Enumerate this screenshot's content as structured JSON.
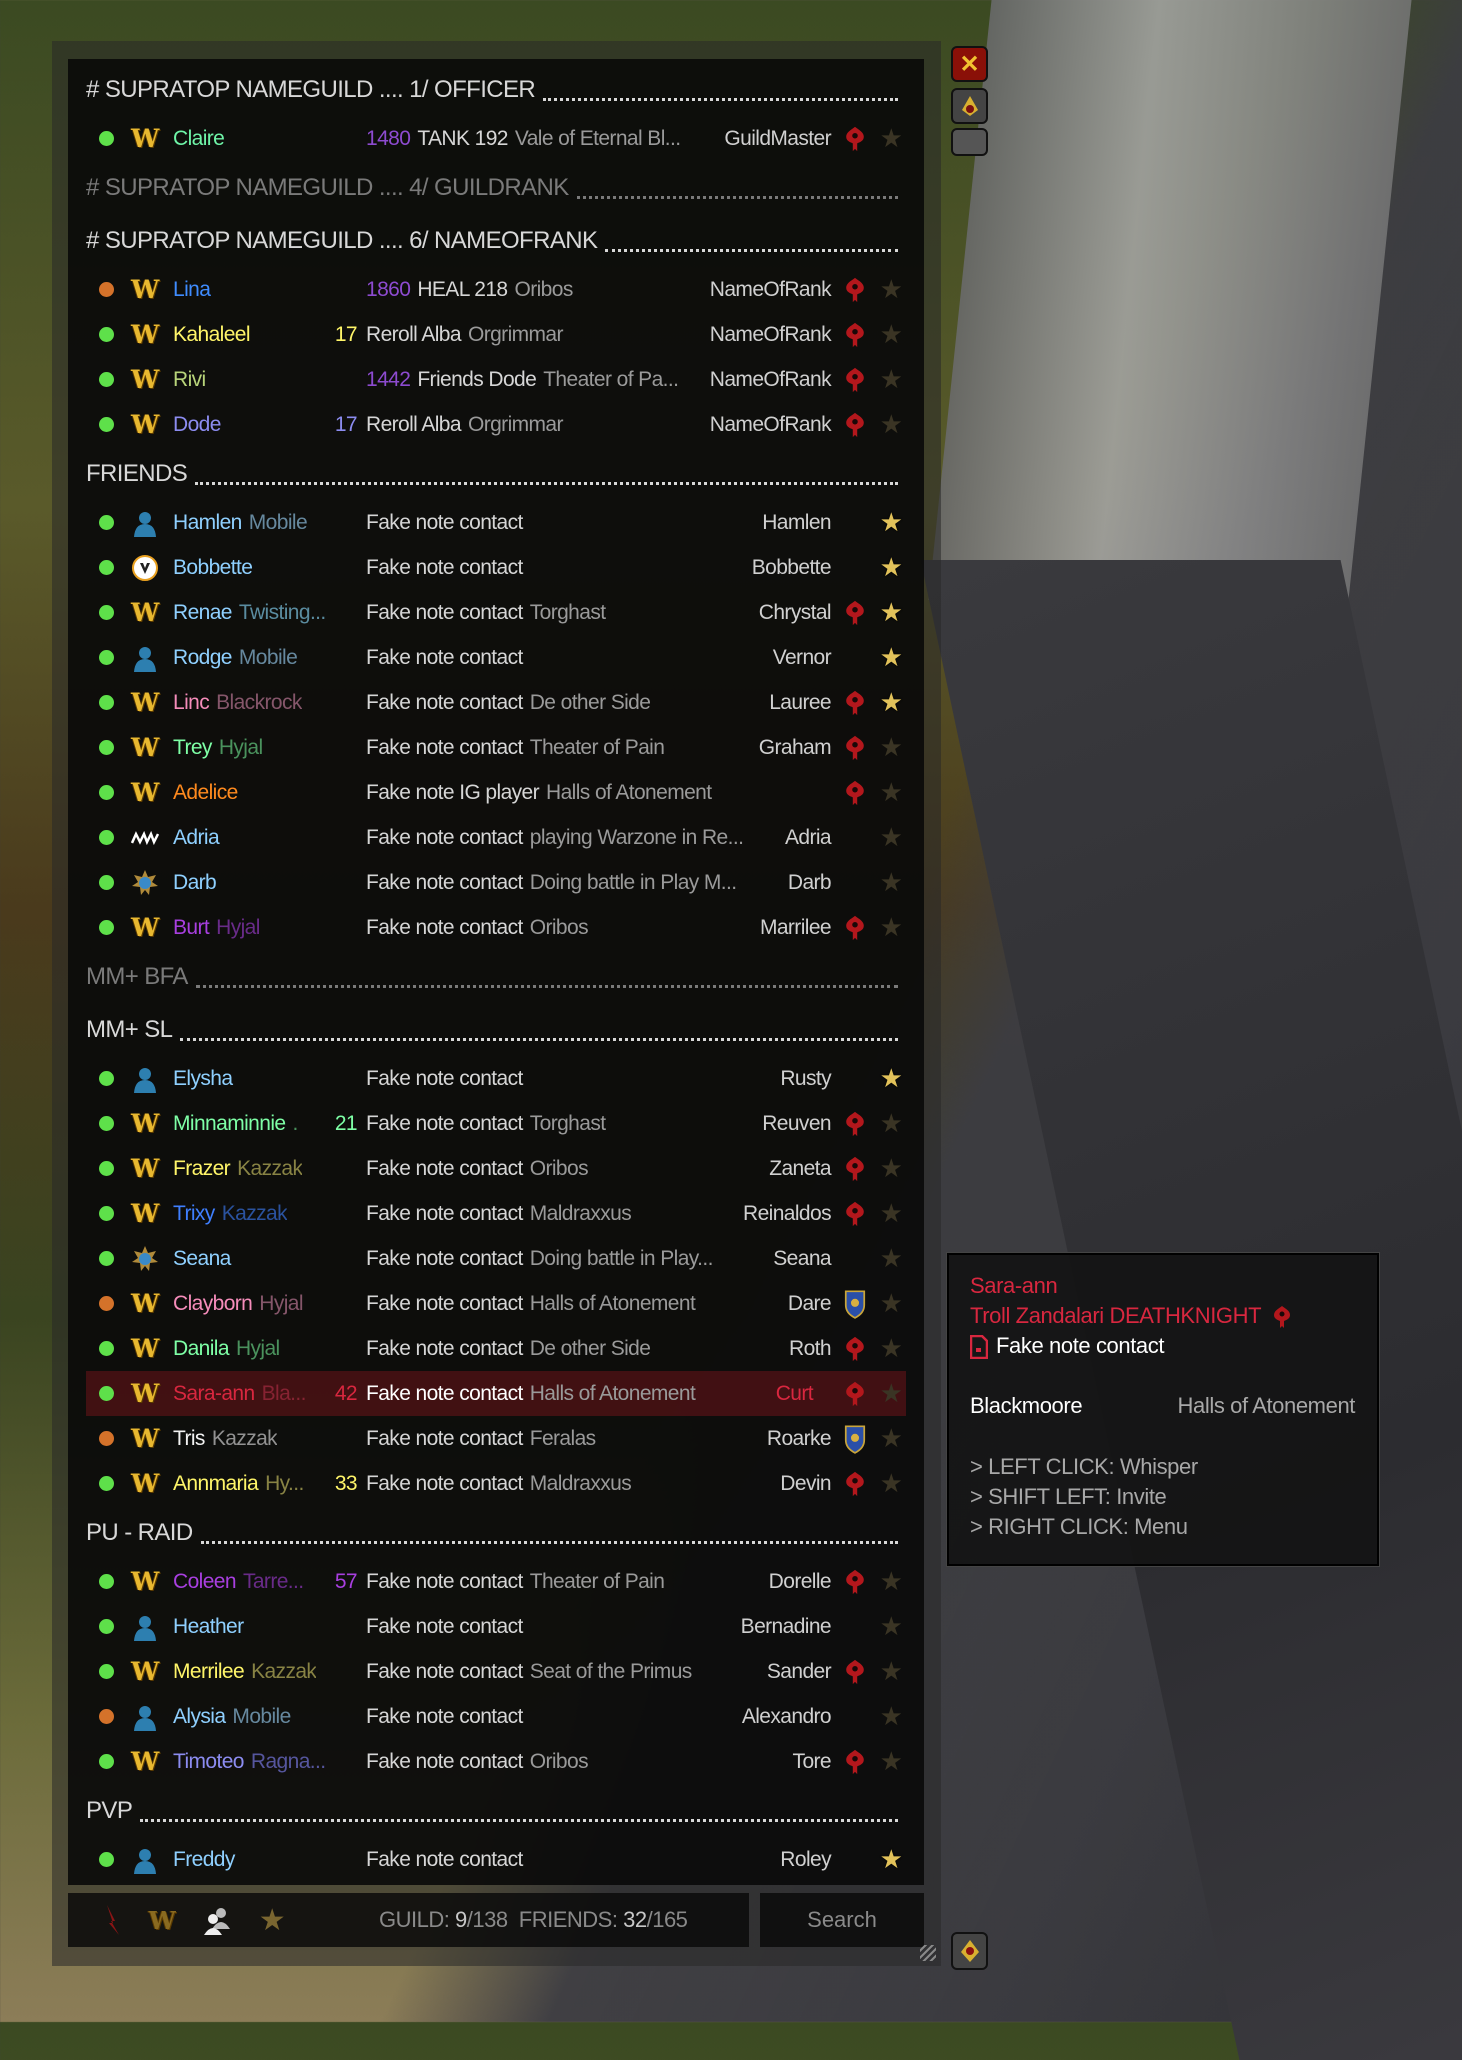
{
  "colors": {
    "online": "#5ee04a",
    "away": "#d4722a",
    "horde": "#b3171c",
    "alliance": "#2a4fa8",
    "highlight": "#6e1419"
  },
  "sections": [
    {
      "title": "# SUPRATOP NAMEGUILD .... 1/ OFFICER",
      "collapsed": false,
      "members": [
        {
          "status": "online",
          "icon": "wow",
          "name": "Claire",
          "nc": "#6ff5a8",
          "realm": "",
          "rc": "",
          "level": "",
          "lc": "",
          "score": "1480",
          "scc": "#8d4bd0",
          "note": "TANK 192",
          "zone": "Vale of Eternal Bl...",
          "rank": "GuildMaster",
          "faction": "horde",
          "fav": false
        }
      ]
    },
    {
      "title": "# SUPRATOP NAMEGUILD .... 4/ GUILDRANK",
      "collapsed": true,
      "members": []
    },
    {
      "title": "# SUPRATOP NAMEGUILD .... 6/ NAMEOFRANK",
      "collapsed": false,
      "members": [
        {
          "status": "away",
          "icon": "wow",
          "name": "Lina",
          "nc": "#3f8cff",
          "realm": "",
          "rc": "",
          "level": "",
          "lc": "",
          "score": "1860",
          "scc": "#8d4bd0",
          "note": "HEAL 218",
          "zone": "Oribos",
          "rank": "NameOfRank",
          "faction": "horde",
          "fav": false
        },
        {
          "status": "online",
          "icon": "wow",
          "name": "Kahaleel",
          "nc": "#fff569",
          "realm": "",
          "rc": "",
          "level": "17",
          "lc": "#fff569",
          "score": "",
          "scc": "",
          "note": "Reroll Alba",
          "zone": "Orgrimmar",
          "rank": "NameOfRank",
          "faction": "horde",
          "fav": false
        },
        {
          "status": "online",
          "icon": "wow",
          "name": "Rivi",
          "nc": "#b8d47a",
          "realm": "",
          "rc": "",
          "level": "",
          "lc": "",
          "score": "1442",
          "scc": "#8d4bd0",
          "note": "Friends Dode",
          "zone": "Theater of Pa...",
          "rank": "NameOfRank",
          "faction": "horde",
          "fav": false
        },
        {
          "status": "online",
          "icon": "wow",
          "name": "Dode",
          "nc": "#8c8cf0",
          "realm": "",
          "rc": "",
          "level": "17",
          "lc": "#8c8cf0",
          "score": "",
          "scc": "",
          "note": "Reroll Alba",
          "zone": "Orgrimmar",
          "rank": "NameOfRank",
          "faction": "horde",
          "fav": false
        }
      ]
    },
    {
      "title": "FRIENDS",
      "collapsed": false,
      "members": [
        {
          "status": "online",
          "icon": "bnet",
          "name": "Hamlen",
          "nc": "#8fd0ff",
          "realm": "Mobile",
          "rc": "#6b8fa6",
          "level": "",
          "lc": "",
          "score": "",
          "scc": "",
          "note": "Fake note contact",
          "zone": "",
          "rank": "Hamlen",
          "faction": "none",
          "fav": true
        },
        {
          "status": "online",
          "icon": "overwatch",
          "name": "Bobbette",
          "nc": "#8fd0ff",
          "realm": "",
          "rc": "",
          "level": "",
          "lc": "",
          "score": "",
          "scc": "",
          "note": "Fake note contact",
          "zone": "",
          "rank": "Bobbette",
          "faction": "none",
          "fav": true
        },
        {
          "status": "online",
          "icon": "wow",
          "name": "Renae",
          "nc": "#8fd0ff",
          "realm": "Twisting...",
          "rc": "#5f93a8",
          "level": "",
          "lc": "",
          "score": "",
          "scc": "",
          "note": "Fake note contact",
          "zone": "Torghast",
          "rank": "Chrystal",
          "faction": "horde",
          "fav": true
        },
        {
          "status": "online",
          "icon": "bnet",
          "name": "Rodge",
          "nc": "#8fd0ff",
          "realm": "Mobile",
          "rc": "#6b8fa6",
          "level": "",
          "lc": "",
          "score": "",
          "scc": "",
          "note": "Fake note contact",
          "zone": "",
          "rank": "Vernor",
          "faction": "none",
          "fav": true
        },
        {
          "status": "online",
          "icon": "wow",
          "name": "Linc",
          "nc": "#f58cba",
          "realm": "Blackrock",
          "rc": "#8c5a70",
          "level": "",
          "lc": "",
          "score": "",
          "scc": "",
          "note": "Fake note contact",
          "zone": "De other Side",
          "rank": "Lauree",
          "faction": "horde",
          "fav": true
        },
        {
          "status": "online",
          "icon": "wow",
          "name": "Trey",
          "nc": "#7effa6",
          "realm": "Hyjal",
          "rc": "#4e9a62",
          "level": "",
          "lc": "",
          "score": "",
          "scc": "",
          "note": "Fake note contact",
          "zone": "Theater of Pain",
          "rank": "Graham",
          "faction": "horde",
          "fav": false
        },
        {
          "status": "online",
          "icon": "wow",
          "name": "Adelice",
          "nc": "#ff8a1e",
          "realm": "",
          "rc": "",
          "level": "",
          "lc": "",
          "score": "",
          "scc": "",
          "note": "Fake note IG player",
          "zone": "Halls of Atonement",
          "rank": "",
          "faction": "horde",
          "fav": false
        },
        {
          "status": "online",
          "icon": "cod",
          "name": "Adria",
          "nc": "#8fd0ff",
          "realm": "",
          "rc": "",
          "level": "",
          "lc": "",
          "score": "",
          "scc": "",
          "note": "Fake note contact",
          "zone": "playing Warzone in Re...",
          "rank": "Adria",
          "faction": "none",
          "fav": false
        },
        {
          "status": "online",
          "icon": "hearthstone",
          "name": "Darb",
          "nc": "#8fd0ff",
          "realm": "",
          "rc": "",
          "level": "",
          "lc": "",
          "score": "",
          "scc": "",
          "note": "Fake note contact",
          "zone": "Doing battle in Play M...",
          "rank": "Darb",
          "faction": "none",
          "fav": false
        },
        {
          "status": "online",
          "icon": "wow",
          "name": "Burt",
          "nc": "#a83fe0",
          "realm": "Hyjal",
          "rc": "#6e2d90",
          "level": "",
          "lc": "",
          "score": "",
          "scc": "",
          "note": "Fake note contact",
          "zone": "Oribos",
          "rank": "Marrilee",
          "faction": "horde",
          "fav": false
        }
      ]
    },
    {
      "title": "MM+ BFA",
      "collapsed": true,
      "members": []
    },
    {
      "title": "MM+ SL",
      "collapsed": false,
      "members": [
        {
          "status": "online",
          "icon": "bnet",
          "name": "Elysha",
          "nc": "#8fd0ff",
          "realm": "",
          "rc": "",
          "level": "",
          "lc": "",
          "score": "",
          "scc": "",
          "note": "Fake note contact",
          "zone": "",
          "rank": "Rusty",
          "faction": "none",
          "fav": true
        },
        {
          "status": "online",
          "icon": "wow",
          "name": "Minnaminnie",
          "nc": "#7effa6",
          "realm": ".",
          "rc": "#4e9a62",
          "level": "21",
          "lc": "#7effa6",
          "score": "",
          "scc": "",
          "note": "Fake note contact",
          "zone": "Torghast",
          "rank": "Reuven",
          "faction": "horde",
          "fav": false
        },
        {
          "status": "online",
          "icon": "wow",
          "name": "Frazer",
          "nc": "#fff569",
          "realm": "Kazzak",
          "rc": "#8f8a48",
          "level": "",
          "lc": "",
          "score": "",
          "scc": "",
          "note": "Fake note contact",
          "zone": "Oribos",
          "rank": "Zaneta",
          "faction": "horde",
          "fav": false
        },
        {
          "status": "online",
          "icon": "wow",
          "name": "Trixy",
          "nc": "#3f7fff",
          "realm": "Kazzak",
          "rc": "#2c56a6",
          "level": "",
          "lc": "",
          "score": "",
          "scc": "",
          "note": "Fake note contact",
          "zone": "Maldraxxus",
          "rank": "Reinaldos",
          "faction": "horde",
          "fav": false
        },
        {
          "status": "online",
          "icon": "hearthstone",
          "name": "Seana",
          "nc": "#8fd0ff",
          "realm": "",
          "rc": "",
          "level": "",
          "lc": "",
          "score": "",
          "scc": "",
          "note": "Fake note contact",
          "zone": "Doing battle in Play...",
          "rank": "Seana",
          "faction": "none",
          "fav": false
        },
        {
          "status": "away",
          "icon": "wow",
          "name": "Clayborn",
          "nc": "#f58cba",
          "realm": "Hyjal",
          "rc": "#8c5a70",
          "level": "",
          "lc": "",
          "score": "",
          "scc": "",
          "note": "Fake note contact",
          "zone": "Halls of Atonement",
          "rank": "Dare",
          "faction": "alliance",
          "fav": false
        },
        {
          "status": "online",
          "icon": "wow",
          "name": "Danila",
          "nc": "#7effa6",
          "realm": "Hyjal",
          "rc": "#4e9a62",
          "level": "",
          "lc": "",
          "score": "",
          "scc": "",
          "note": "Fake note contact",
          "zone": "De other Side",
          "rank": "Roth",
          "faction": "horde",
          "fav": false
        },
        {
          "status": "online",
          "icon": "wow",
          "name": "Sara-ann",
          "nc": "#d8273f",
          "realm": "Bla...",
          "rc": "#8a2434",
          "level": "42",
          "lc": "#d8273f",
          "score": "",
          "scc": "",
          "note": "Fake note contact",
          "zone": "Halls of Atonement",
          "rank": "Curt",
          "rkc": "#d8273f",
          "faction": "horde",
          "fav": false,
          "highlight": true
        },
        {
          "status": "away",
          "icon": "wow",
          "name": "Tris",
          "nc": "#f2f2f2",
          "realm": "Kazzak",
          "rc": "#9a9a9a",
          "level": "",
          "lc": "",
          "score": "",
          "scc": "",
          "note": "Fake note contact",
          "zone": "Feralas",
          "rank": "Roarke",
          "faction": "alliance",
          "fav": false
        },
        {
          "status": "online",
          "icon": "wow",
          "name": "Annmaria",
          "nc": "#fff569",
          "realm": "Hy...",
          "rc": "#8f8a48",
          "level": "33",
          "lc": "#fff569",
          "score": "",
          "scc": "",
          "note": "Fake note contact",
          "zone": "Maldraxxus",
          "rank": "Devin",
          "faction": "horde",
          "fav": false
        }
      ]
    },
    {
      "title": "PU - RAID",
      "collapsed": false,
      "members": [
        {
          "status": "online",
          "icon": "wow",
          "name": "Coleen",
          "nc": "#a83fe0",
          "realm": "Tarre...",
          "rc": "#6e2d90",
          "level": "57",
          "lc": "#a83fe0",
          "score": "",
          "scc": "",
          "note": "Fake note contact",
          "zone": "Theater of Pain",
          "rank": "Dorelle",
          "faction": "horde",
          "fav": false
        },
        {
          "status": "online",
          "icon": "bnet",
          "name": "Heather",
          "nc": "#8fd0ff",
          "realm": "",
          "rc": "",
          "level": "",
          "lc": "",
          "score": "",
          "scc": "",
          "note": "Fake note contact",
          "zone": "",
          "rank": "Bernadine",
          "faction": "none",
          "fav": false
        },
        {
          "status": "online",
          "icon": "wow",
          "name": "Merrilee",
          "nc": "#fff569",
          "realm": "Kazzak",
          "rc": "#8f8a48",
          "level": "",
          "lc": "",
          "score": "",
          "scc": "",
          "note": "Fake note contact",
          "zone": "Seat of the Primus",
          "rank": "Sander",
          "faction": "horde",
          "fav": false
        },
        {
          "status": "away",
          "icon": "bnet",
          "name": "Alysia",
          "nc": "#8fd0ff",
          "realm": "Mobile",
          "rc": "#6b8fa6",
          "level": "",
          "lc": "",
          "score": "",
          "scc": "",
          "note": "Fake note contact",
          "zone": "",
          "rank": "Alexandro",
          "faction": "none",
          "fav": false
        },
        {
          "status": "online",
          "icon": "wow",
          "name": "Timoteo",
          "nc": "#8c8cf0",
          "realm": "Ragna...",
          "rc": "#5a5aa6",
          "level": "",
          "lc": "",
          "score": "",
          "scc": "",
          "note": "Fake note contact",
          "zone": "Oribos",
          "rank": "Tore",
          "faction": "horde",
          "fav": false
        }
      ]
    },
    {
      "title": "PVP",
      "collapsed": false,
      "members": [
        {
          "status": "online",
          "icon": "bnet",
          "name": "Freddy",
          "nc": "#8fd0ff",
          "realm": "",
          "rc": "",
          "level": "",
          "lc": "",
          "score": "",
          "scc": "",
          "note": "Fake note contact",
          "zone": "",
          "rank": "Roley",
          "faction": "none",
          "fav": true
        }
      ]
    }
  ],
  "footer": {
    "guild_label": "GUILD:",
    "guild_online": "9",
    "guild_total": "/138",
    "friends_label": "FRIENDS:",
    "friends_online": "32",
    "friends_total": "/165",
    "search_label": "Search",
    "icons": [
      "horde-filter-icon",
      "wow-filter-icon",
      "friends-filter-icon",
      "favorite-filter-icon"
    ]
  },
  "side_buttons": [
    "close-icon",
    "horde-emblem-icon",
    "blank-button"
  ],
  "tooltip": {
    "name": "Sara-ann",
    "race_class": "Troll Zandalari DEATHKNIGHT",
    "note": "Fake note contact",
    "realm": "Blackmoore",
    "zone": "Halls of Atonement",
    "hints": [
      "> LEFT CLICK: Whisper",
      "> SHIFT LEFT: Invite",
      "> RIGHT CLICK: Menu"
    ],
    "color": "#d8273f"
  }
}
